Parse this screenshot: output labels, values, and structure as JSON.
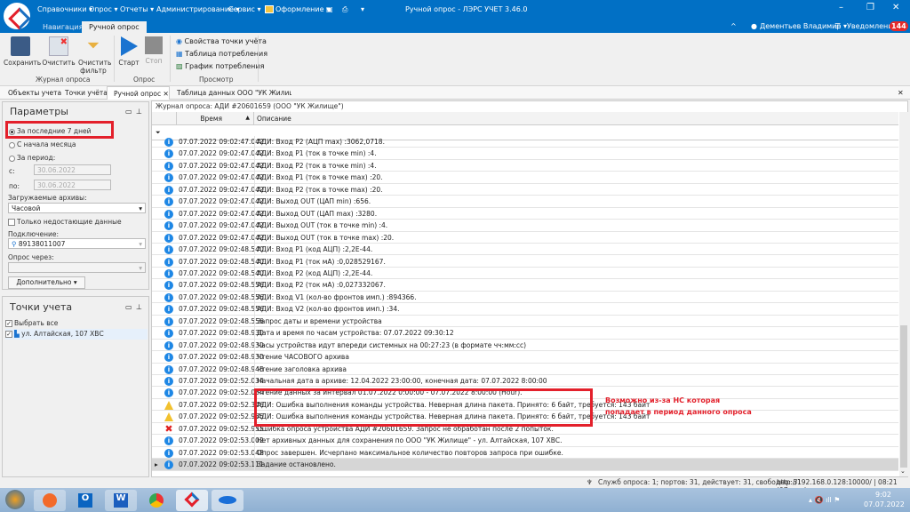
{
  "app": {
    "title": "Ручной опрос - ЛЭРС УЧЕТ 3.46.0",
    "menu": [
      "Справочники ▾",
      "Опрос ▾",
      "Отчеты ▾",
      "Администрирование ▾",
      "Сервис ▾",
      "Оформление ▾"
    ],
    "tabs": [
      "Навигация",
      "Ручной опрос"
    ],
    "user": "Дементьев Владимир ▾",
    "notifications": "Уведомления",
    "notif_count": "144"
  },
  "ribbon": {
    "save": "Сохранить",
    "clear": "Очистить",
    "clear_filter": "Очистить фильтр",
    "group_journal": "Журнал опроса",
    "start": "Старт",
    "stop": "Стоп",
    "group_poll": "Опрос",
    "view_items": [
      "Свойства точки учёта",
      "Таблица потребления",
      "График потребления"
    ],
    "group_view": "Просмотр"
  },
  "doc_tabs": [
    "Объекты учета",
    "Точки учёта",
    "Ручной опрос",
    "Таблица данных ООО \"УК Жилище\" - ул"
  ],
  "params": {
    "title": "Параметры",
    "last7": "За последние 7 дней",
    "month_start": "С начала месяца",
    "period": "За период:",
    "from_label": "с:",
    "from": "30.06.2022",
    "to_label": "по:",
    "to": "30.06.2022",
    "archives_label": "Загружаемые архивы:",
    "archive": "Часовой",
    "only_missing": "Только недостающие данные",
    "connection_label": "Подключение:",
    "connection": "89138011007",
    "via_label": "Опрос через:",
    "via": "",
    "more": "Дополнительно"
  },
  "points": {
    "title": "Точки учета",
    "select_all": "Выбрать все",
    "items": [
      "ул. Алтайская, 107 ХВС"
    ]
  },
  "journal": {
    "title": "Журнал опроса: АДИ #20601659 (ООО \"УК Жилище\")",
    "col_time": "Время",
    "col_desc": "Описание",
    "annotation": "Возможно из-за НС которая попадает в период данного опроса",
    "rows": [
      {
        "type": "info",
        "time": "07.07.2022 09:02:47.042",
        "desc": "АДИ: Вход P2 (АЦП max) :3062,0718."
      },
      {
        "type": "info",
        "time": "07.07.2022 09:02:47.042",
        "desc": "АДИ: Вход P1 (ток в точке min) :4."
      },
      {
        "type": "info",
        "time": "07.07.2022 09:02:47.042",
        "desc": "АДИ: Вход P2 (ток в точке min) :4."
      },
      {
        "type": "info",
        "time": "07.07.2022 09:02:47.042",
        "desc": "АДИ: Вход P1 (ток в точке max) :20."
      },
      {
        "type": "info",
        "time": "07.07.2022 09:02:47.042",
        "desc": "АДИ: Вход P2 (ток в точке max) :20."
      },
      {
        "type": "info",
        "time": "07.07.2022 09:02:47.042",
        "desc": "АДИ: Выход OUT (ЦАП min) :656."
      },
      {
        "type": "info",
        "time": "07.07.2022 09:02:47.042",
        "desc": "АДИ: Выход OUT (ЦАП max) :3280."
      },
      {
        "type": "info",
        "time": "07.07.2022 09:02:47.042",
        "desc": "АДИ: Выход OUT (ток в точке min) :4."
      },
      {
        "type": "info",
        "time": "07.07.2022 09:02:47.042",
        "desc": "АДИ: Выход OUT (ток в точке max) :20."
      },
      {
        "type": "info",
        "time": "07.07.2022 09:02:48.540",
        "desc": "АДИ: Вход P1 (код АЦП) :2,2E-44."
      },
      {
        "type": "info",
        "time": "07.07.2022 09:02:48.540",
        "desc": "АДИ: Вход P1 (ток мА) :0,028529167."
      },
      {
        "type": "info",
        "time": "07.07.2022 09:02:48.540",
        "desc": "АДИ: Вход P2 (код АЦП) :2,2E-44."
      },
      {
        "type": "info",
        "time": "07.07.2022 09:02:48.556",
        "desc": "АДИ: Вход P2 (ток мА) :0,027332067."
      },
      {
        "type": "info",
        "time": "07.07.2022 09:02:48.556",
        "desc": "АДИ: Вход V1 (кол-во фронтов имп.) :894366."
      },
      {
        "type": "info",
        "time": "07.07.2022 09:02:48.556",
        "desc": "АДИ: Вход V2 (кол-во фронтов имп.) :34."
      },
      {
        "type": "info",
        "time": "07.07.2022 09:02:48.556",
        "desc": "Запрос даты и времени устройства"
      },
      {
        "type": "info",
        "time": "07.07.2022 09:02:48.930",
        "desc": "Дата и время по часам устройства: 07.07.2022 09:30:12"
      },
      {
        "type": "info",
        "time": "07.07.2022 09:02:48.930",
        "desc": "Часы устройства идут впереди системных на 00:27:23 (в формате чч:мм:сс)"
      },
      {
        "type": "info",
        "time": "07.07.2022 09:02:48.930",
        "desc": "Чтение ЧАСОВОГО архива"
      },
      {
        "type": "info",
        "time": "07.07.2022 09:02:48.946",
        "desc": "Чтение заголовка архива"
      },
      {
        "type": "info",
        "time": "07.07.2022 09:02:52.034",
        "desc": "Начальная дата в архиве: 12.04.2022 23:00:00, конечная дата: 07.07.2022 8:00:00"
      },
      {
        "type": "info",
        "time": "07.07.2022 09:02:52.034",
        "desc": "Чтение данных за интервал 01.07.2022 0:00:00 - 07.07.2022 8:00:00 (Hour)."
      },
      {
        "type": "warning",
        "time": "07.07.2022 09:02:52.346",
        "desc": "АДИ: Ошибка выполнения команды устройства. Неверная длина пакета. Принято: 6 байт, требуется: 143 байт"
      },
      {
        "type": "warning",
        "time": "07.07.2022 09:02:52.955",
        "desc": "АДИ: Ошибка выполнения команды устройства. Неверная длина пакета. Принято: 6 байт, требуется: 143 байт"
      },
      {
        "type": "error",
        "time": "07.07.2022 09:02:52.955",
        "desc": "Ошибка опроса устройства АДИ #20601659. Запрос не обработан после 2 попыток."
      },
      {
        "type": "info",
        "time": "07.07.2022 09:02:53.002",
        "desc": "Нет архивных данных для сохранения по ООО \"УК Жилище\" - ул. Алтайская, 107 ХВС."
      },
      {
        "type": "info",
        "time": "07.07.2022 09:02:53.048",
        "desc": "Опрос завершен. Исчерпано максимальное количество повторов запроса при ошибке."
      },
      {
        "type": "info",
        "time": "07.07.2022 09:02:53.111",
        "desc": "Задание остановлено.",
        "selected": true
      }
    ]
  },
  "status": {
    "services": "Служб опроса: 1; портов: 31, действует: 31, свободно: 31",
    "server": "http://192.168.0.128:10000/ | 08:21 (07 июл)"
  },
  "taskbar": {
    "time": "9:02",
    "date": "07.07.2022",
    "apps": [
      "firefox",
      "outlook",
      "word",
      "chrome",
      "lers",
      "app"
    ]
  },
  "colors": {
    "accent": "#0170c5",
    "highlight": "#e3202b",
    "info": "#1e87e5",
    "warning": "#f2c12e"
  }
}
